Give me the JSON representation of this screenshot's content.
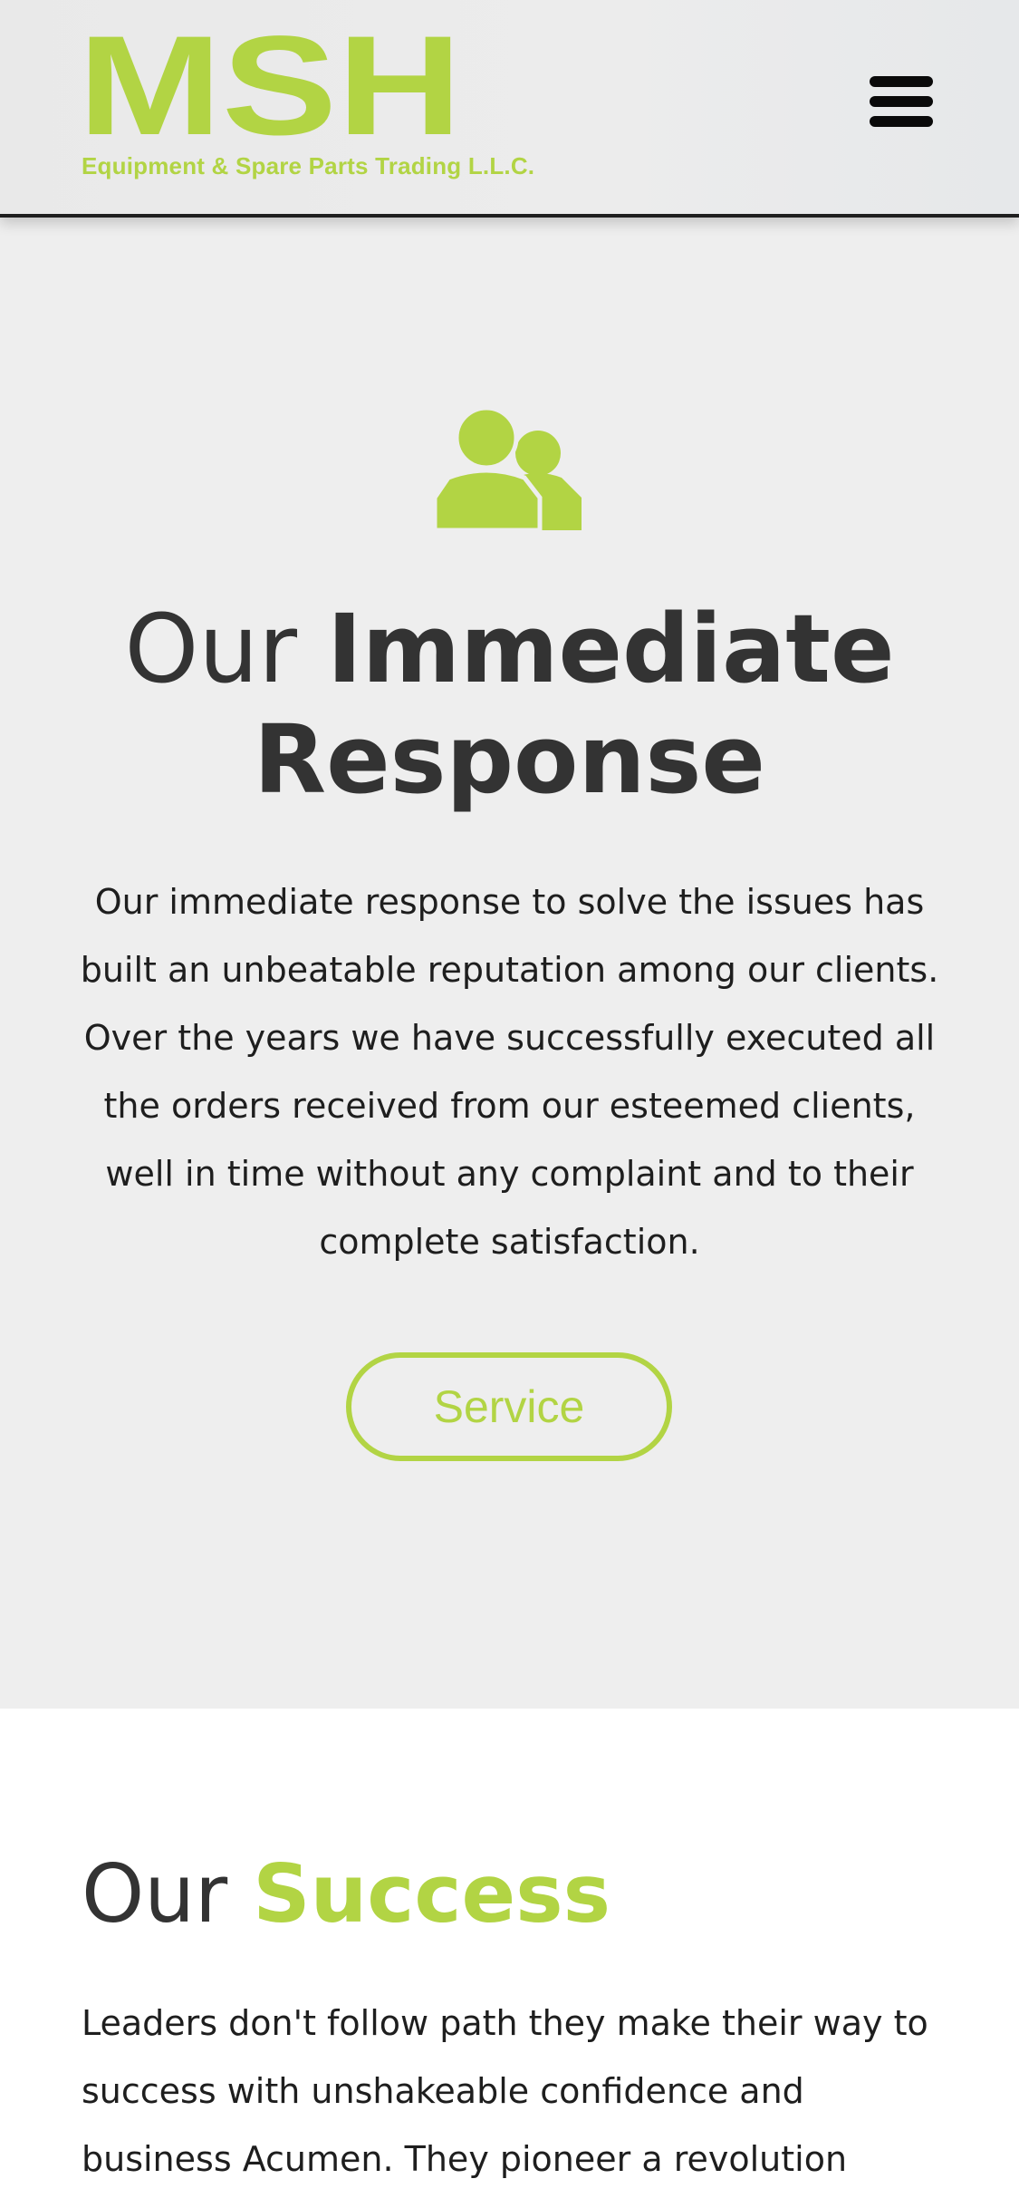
{
  "header": {
    "logo_text": "MSH",
    "logo_subtitle": "Equipment & Spare Parts Trading L.L.C.",
    "menu_icon": "hamburger-menu-icon"
  },
  "response": {
    "icon": "users-icon",
    "title_light": "Our ",
    "title_bold": "Immediate Response",
    "text": "Our immediate response to solve the issues has built an unbeatable reputation among our clients. Over the years we have successfully executed all the orders received from our esteemed clients, well in time without any complaint and to their complete satisfaction.",
    "button_label": "Service"
  },
  "success": {
    "title_dark": "Our ",
    "title_accent": "Success",
    "text": "Leaders don't follow path they make their way to success with unshakeable confidence and business Acumen. They pioneer a revolution"
  },
  "colors": {
    "accent": "#b2d444",
    "text_dark": "#333333",
    "section_bg": "#eeeeee"
  }
}
